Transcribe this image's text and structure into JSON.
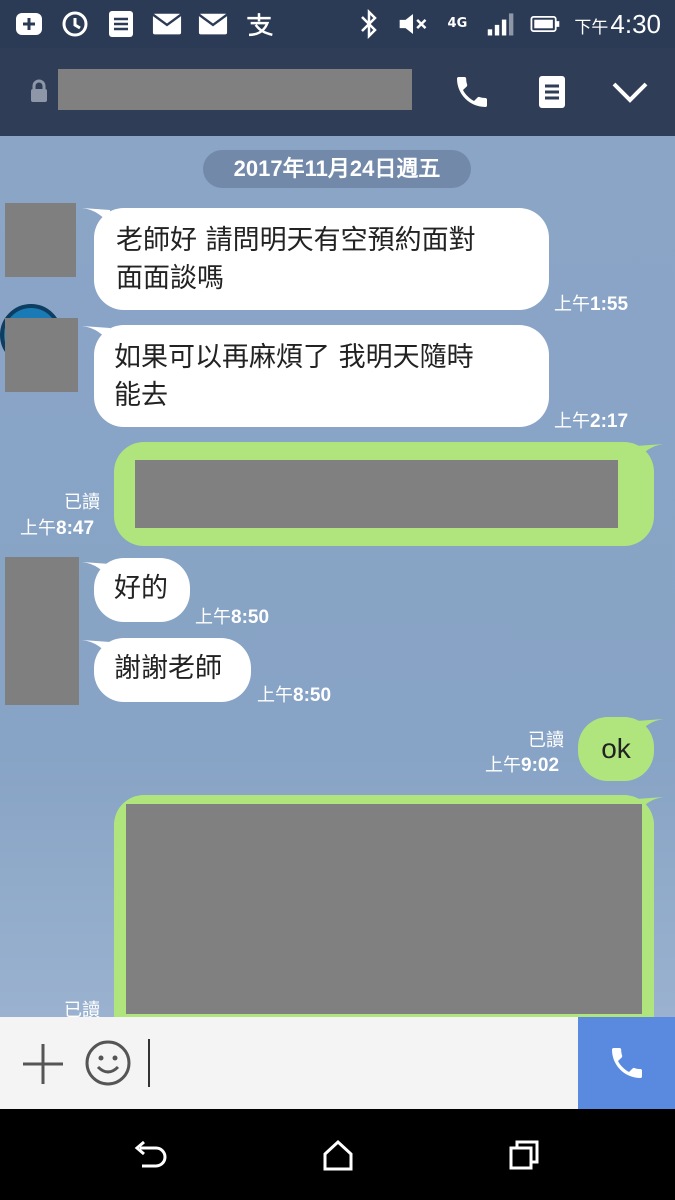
{
  "status_bar": {
    "time_prefix": "下午",
    "time": "4:30",
    "network": "4G"
  },
  "header": {
    "contact_name": "",
    "call_icon": "phone-icon",
    "notes_icon": "notes-icon",
    "menu_icon": "chevron-down-icon"
  },
  "chat": {
    "date": "2017年11月24日週五",
    "messages": [
      {
        "side": "left",
        "text_line1": "老師好 請問明天有空預約面對",
        "text_line2": "面面談嗎",
        "time_prefix": "上午",
        "time": "1:55"
      },
      {
        "side": "left",
        "text_line1": "如果可以再麻煩了 我明天隨時",
        "text_line2": "能去",
        "time_prefix": "上午",
        "time": "2:17"
      },
      {
        "side": "right",
        "read": "已讀",
        "time_prefix": "上午",
        "time": "8:47",
        "text": ""
      },
      {
        "side": "left",
        "text": "好的",
        "time_prefix": "上午",
        "time": "8:50"
      },
      {
        "side": "left",
        "text": "謝謝老師",
        "time_prefix": "上午",
        "time": "8:50"
      },
      {
        "side": "right",
        "text": "ok",
        "read": "已讀",
        "time_prefix": "上午",
        "time": "9:02"
      },
      {
        "side": "right",
        "read": "已讀",
        "text": ""
      }
    ]
  },
  "input": {
    "placeholder": "",
    "value": ""
  },
  "colors": {
    "header_bg": "#2f3d57",
    "chat_bg": "#8aa5c6",
    "my_bubble": "#b0e57e",
    "their_bubble": "#ffffff",
    "call_button": "#5a89e0"
  }
}
